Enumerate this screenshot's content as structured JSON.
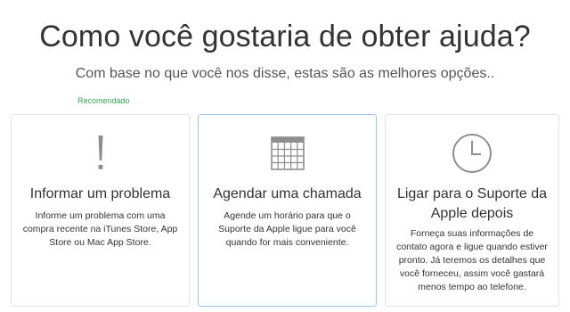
{
  "header": {
    "title": "Como você gostaria de obter ajuda?",
    "subtitle": "Com base no que você nos disse, estas são as melhores opções.."
  },
  "recommended_label": "Recomendado",
  "options": [
    {
      "icon": "exclamation-icon",
      "title": "Informar um problema",
      "description": "Informe um problema com uma compra recente na iTunes Store, App Store ou Mac App Store."
    },
    {
      "icon": "calendar-icon",
      "title": "Agendar uma chamada",
      "description": "Agende um horário para que o Suporte da Apple ligue para você quando for mais conveniente."
    },
    {
      "icon": "clock-icon",
      "title": "Ligar para o Suporte da Apple depois",
      "description": "Forneça suas informações de contato agora e ligue quando estiver pronto. Já teremos os detalhes que você forneceu, assim você gastará menos tempo ao telefone."
    }
  ],
  "colors": {
    "recommended": "#3aa856",
    "selected_border": "#9fc2ea",
    "icon_gray": "#8e8e8e"
  }
}
